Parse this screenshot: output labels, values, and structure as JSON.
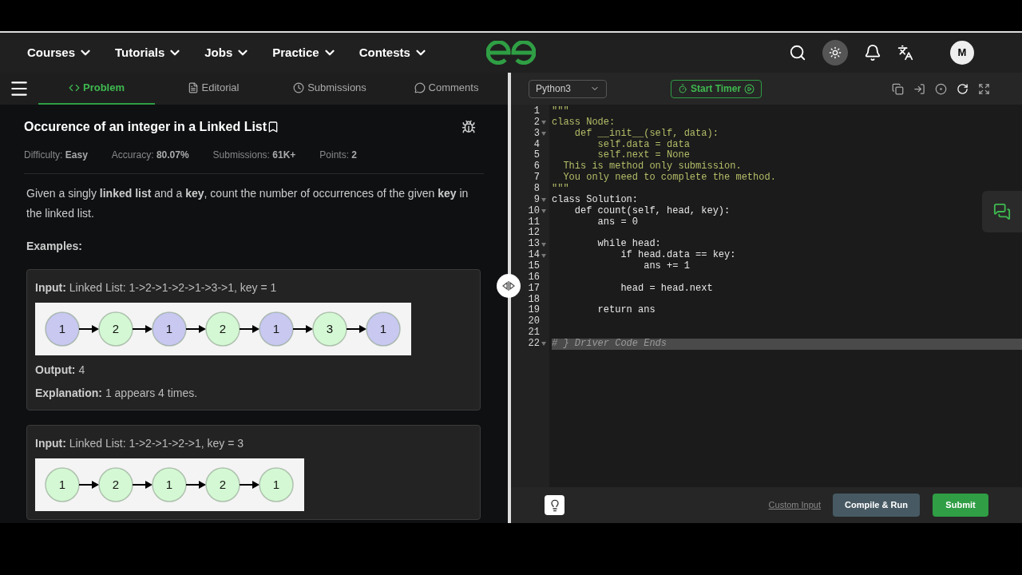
{
  "nav": {
    "items": [
      {
        "label": "Courses"
      },
      {
        "label": "Tutorials"
      },
      {
        "label": "Jobs"
      },
      {
        "label": "Practice"
      },
      {
        "label": "Contests"
      }
    ],
    "avatar": "M"
  },
  "tabs": [
    {
      "label": "Problem",
      "selected": true,
      "kind": "code"
    },
    {
      "label": "Editorial",
      "selected": false,
      "kind": "doc"
    },
    {
      "label": "Submissions",
      "selected": false,
      "kind": "clock"
    },
    {
      "label": "Comments",
      "selected": false,
      "kind": "chat"
    }
  ],
  "problem": {
    "title": "Occurence of an integer in a Linked List",
    "meta": [
      {
        "label": "Difficulty:",
        "value": "Easy"
      },
      {
        "label": "Accuracy:",
        "value": "80.07%"
      },
      {
        "label": "Submissions:",
        "value": "61K+"
      },
      {
        "label": "Points:",
        "value": "2"
      }
    ],
    "statement": "Given a singly **linked list** and a **key**, count the number of occurrences of the given **key** in the linked list.",
    "examples_heading": "Examples:",
    "examples": [
      {
        "input_label": "Input:",
        "input": "Linked  List:  1->2->1->2->1->3->1,  key  =  1",
        "nodes": [
          {
            "value": "1",
            "color": "#c8c8f0"
          },
          {
            "value": "2",
            "color": "#d4f8d4"
          },
          {
            "value": "1",
            "color": "#c8c8f0"
          },
          {
            "value": "2",
            "color": "#d4f8d4"
          },
          {
            "value": "1",
            "color": "#c8c8f0"
          },
          {
            "value": "3",
            "color": "#d4f8d4"
          },
          {
            "value": "1",
            "color": "#c8c8f0"
          }
        ],
        "output_label": "Output:",
        "output": "4",
        "explanation_label": "Explanation:",
        "explanation": "1  appears  4  times."
      },
      {
        "input_label": "Input:",
        "input": "Linked  List:  1->2->1->2->1,  key  =  3",
        "nodes": [
          {
            "value": "1",
            "color": "#d4f8d4"
          },
          {
            "value": "2",
            "color": "#d4f8d4"
          },
          {
            "value": "1",
            "color": "#d4f8d4"
          },
          {
            "value": "2",
            "color": "#d4f8d4"
          },
          {
            "value": "1",
            "color": "#d4f8d4"
          }
        ]
      }
    ]
  },
  "editor": {
    "language": "Python3",
    "timer": "Start Timer",
    "lines": [
      {
        "n": "1",
        "fold": false,
        "kind": "docstring",
        "text": "\"\"\""
      },
      {
        "n": "2",
        "fold": true,
        "kind": "docstring",
        "text": "class Node:"
      },
      {
        "n": "3",
        "fold": true,
        "kind": "docstring",
        "text": "    def __init__(self, data):"
      },
      {
        "n": "4",
        "fold": false,
        "kind": "docstring",
        "text": "        self.data = data"
      },
      {
        "n": "5",
        "fold": false,
        "kind": "docstring",
        "text": "        self.next = None"
      },
      {
        "n": "6",
        "fold": false,
        "kind": "docstring",
        "text": "  This is method only submission."
      },
      {
        "n": "7",
        "fold": false,
        "kind": "docstring",
        "text": "  You only need to complete the method."
      },
      {
        "n": "8",
        "fold": false,
        "kind": "docstring",
        "text": "\"\"\""
      },
      {
        "n": "9",
        "fold": true,
        "kind": "code",
        "text": "class Solution:"
      },
      {
        "n": "10",
        "fold": true,
        "kind": "code",
        "text": "    def count(self, head, key):"
      },
      {
        "n": "11",
        "fold": false,
        "kind": "code",
        "text": "        ans = 0"
      },
      {
        "n": "12",
        "fold": false
      },
      {
        "n": "13",
        "fold": true,
        "kind": "code",
        "text": "        while head:"
      },
      {
        "n": "14",
        "fold": true,
        "kind": "code",
        "text": "            if head.data == key:"
      },
      {
        "n": "15",
        "fold": false,
        "kind": "code",
        "text": "                ans += 1"
      },
      {
        "n": "16",
        "fold": false
      },
      {
        "n": "17",
        "fold": false,
        "kind": "code",
        "text": "            head = head.next"
      },
      {
        "n": "18",
        "fold": false
      },
      {
        "n": "19",
        "fold": false,
        "kind": "code",
        "text": "        return ans"
      },
      {
        "n": "20",
        "fold": false
      },
      {
        "n": "21",
        "fold": false
      },
      {
        "n": "22",
        "fold": true,
        "kind": "faded",
        "text": "# } Driver Code Ends"
      }
    ],
    "custom_input": "Custom Input",
    "run": "Compile & Run",
    "submit": "Submit"
  }
}
